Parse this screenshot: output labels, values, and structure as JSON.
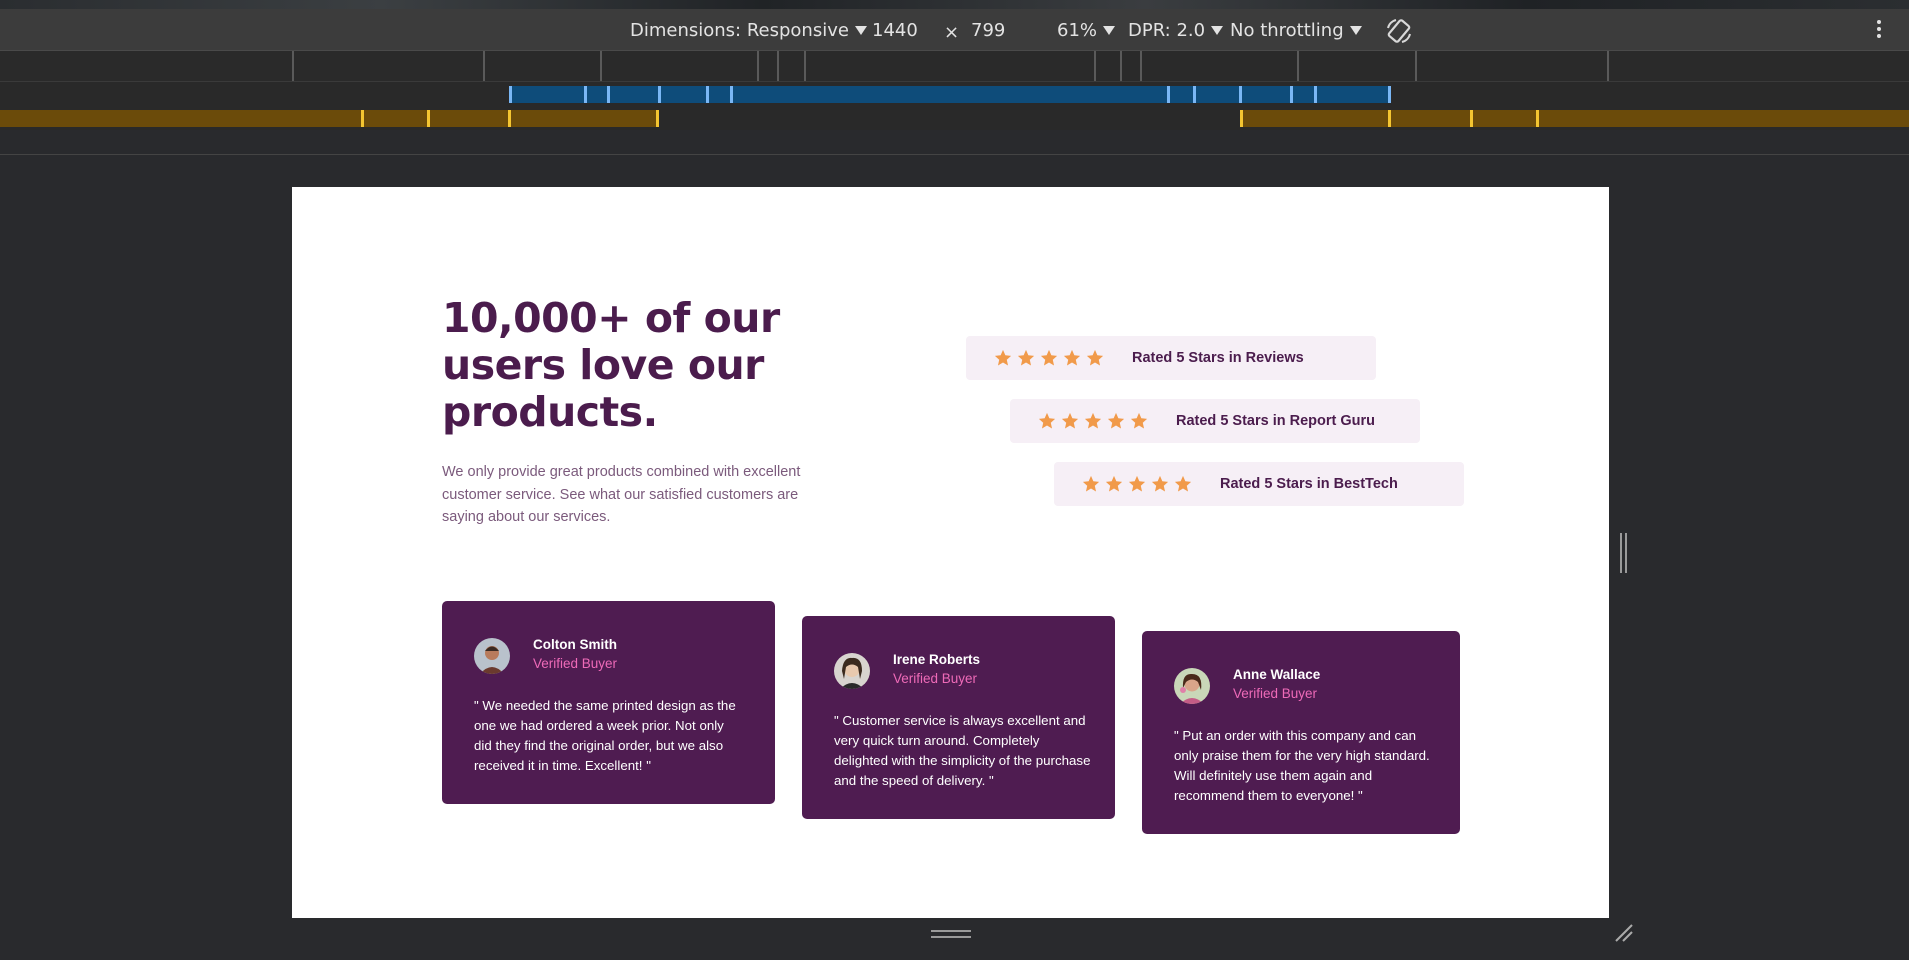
{
  "devtools": {
    "dimensions_label": "Dimensions: Responsive",
    "width": "1440",
    "times": "×",
    "height": "799",
    "zoom": "61%",
    "dpr": "DPR: 2.0",
    "throttling": "No throttling",
    "icons": [
      "rotate-icon",
      "more-options-icon",
      "caret-down-icon"
    ]
  },
  "page": {
    "headline": "10,000+ of our users love our products.",
    "intro": "We only provide great products combined with excellent customer service. See what our satisfied customers are saying about our services.",
    "ratings": [
      {
        "label": "Rated 5 Stars in Reviews",
        "stars": 5
      },
      {
        "label": "Rated 5 Stars in Report Guru",
        "stars": 5
      },
      {
        "label": "Rated 5 Stars in BestTech",
        "stars": 5
      }
    ],
    "testimonials": [
      {
        "name": "Colton Smith",
        "role": "Verified Buyer",
        "quote": "\" We needed the same printed design as the one we had ordered a week prior. Not only did they find the original order, but we also received it in time. Excellent! \""
      },
      {
        "name": "Irene Roberts",
        "role": "Verified Buyer",
        "quote": "\" Customer service is always excellent and very quick turn around. Completely delighted with the simplicity of the purchase and the speed of delivery. \""
      },
      {
        "name": "Anne Wallace",
        "role": "Verified Buyer",
        "quote": "\" Put an order with this company and can only praise them for the very high standard. Will definitely use them again and recommend them to everyone! \""
      }
    ]
  },
  "colors": {
    "devtools_bg": "#3c3c3c",
    "heading": "#4b1c4d",
    "card_bg": "#4f1c51",
    "role_pink": "#ee6ab8",
    "star": "#f19a4a",
    "rating_bg": "#f6eff6"
  }
}
